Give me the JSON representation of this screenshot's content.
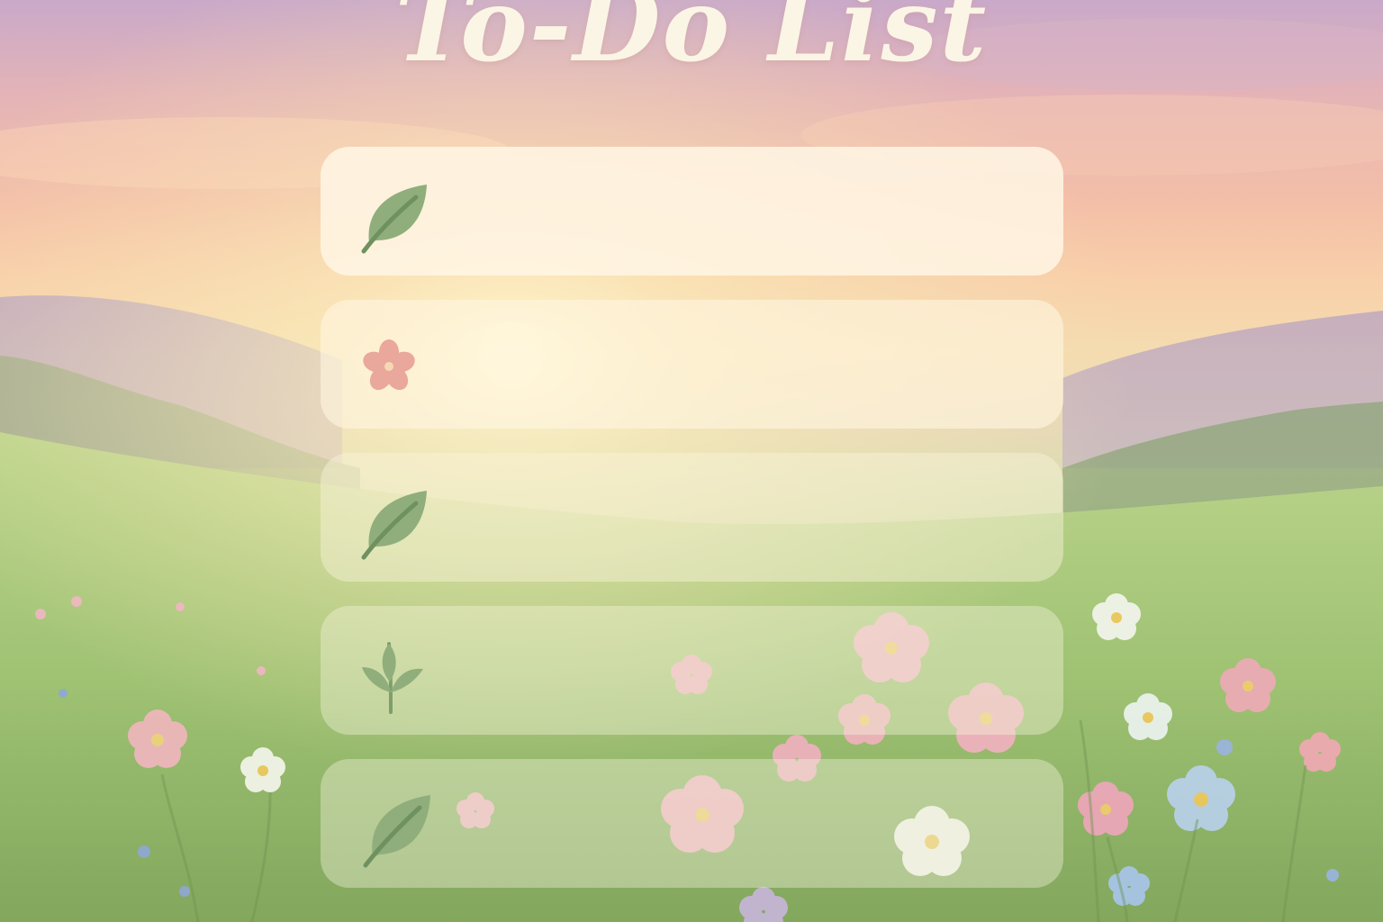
{
  "app": {
    "title": "To-Do List"
  },
  "todo": {
    "items": [
      {
        "icon": "leaf-icon",
        "text": ""
      },
      {
        "icon": "flower-icon",
        "text": ""
      },
      {
        "icon": "leaf-icon",
        "text": ""
      },
      {
        "icon": "sprout-icon",
        "text": ""
      },
      {
        "icon": "leaf-icon",
        "text": ""
      }
    ]
  },
  "colors": {
    "title": "#fbf5e6",
    "leaf": "#8fae7c",
    "flower": "#eaa79c",
    "card": "#fff6e4"
  }
}
